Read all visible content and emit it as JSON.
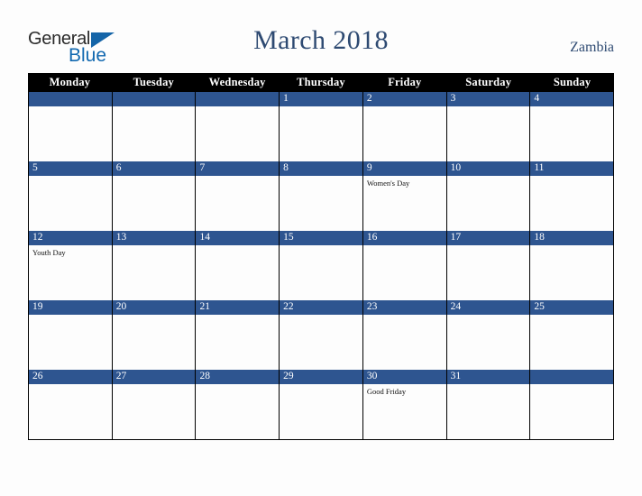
{
  "brand": {
    "name_part1": "General",
    "name_part2": "Blue",
    "triangle_icon": "blue-triangle-icon",
    "colors": {
      "general_text": "#2b2b2b",
      "blue_text": "#1269b0",
      "triangle": "#1565a8"
    }
  },
  "header": {
    "title": "March 2018",
    "country": "Zambia",
    "title_color": "#2e4a72"
  },
  "calendar": {
    "month": "March",
    "year": "2018",
    "weekday_headers": [
      "Monday",
      "Tuesday",
      "Wednesday",
      "Thursday",
      "Friday",
      "Saturday",
      "Sunday"
    ],
    "header_bg": "#000000",
    "header_text_color": "#ffffff",
    "date_bar_color": "#2e5590",
    "date_text_color": "#ffffff",
    "cell_bg": "#fdfdfd",
    "grid_line_color": "#000000",
    "weeks": [
      [
        {
          "num": "",
          "events": []
        },
        {
          "num": "",
          "events": []
        },
        {
          "num": "",
          "events": []
        },
        {
          "num": "1",
          "events": []
        },
        {
          "num": "2",
          "events": []
        },
        {
          "num": "3",
          "events": []
        },
        {
          "num": "4",
          "events": []
        }
      ],
      [
        {
          "num": "5",
          "events": []
        },
        {
          "num": "6",
          "events": []
        },
        {
          "num": "7",
          "events": []
        },
        {
          "num": "8",
          "events": []
        },
        {
          "num": "9",
          "events": [
            "Women's Day"
          ]
        },
        {
          "num": "10",
          "events": []
        },
        {
          "num": "11",
          "events": []
        }
      ],
      [
        {
          "num": "12",
          "events": [
            "Youth Day"
          ]
        },
        {
          "num": "13",
          "events": []
        },
        {
          "num": "14",
          "events": []
        },
        {
          "num": "15",
          "events": []
        },
        {
          "num": "16",
          "events": []
        },
        {
          "num": "17",
          "events": []
        },
        {
          "num": "18",
          "events": []
        }
      ],
      [
        {
          "num": "19",
          "events": []
        },
        {
          "num": "20",
          "events": []
        },
        {
          "num": "21",
          "events": []
        },
        {
          "num": "22",
          "events": []
        },
        {
          "num": "23",
          "events": []
        },
        {
          "num": "24",
          "events": []
        },
        {
          "num": "25",
          "events": []
        }
      ],
      [
        {
          "num": "26",
          "events": []
        },
        {
          "num": "27",
          "events": []
        },
        {
          "num": "28",
          "events": []
        },
        {
          "num": "29",
          "events": []
        },
        {
          "num": "30",
          "events": [
            "Good Friday"
          ]
        },
        {
          "num": "31",
          "events": []
        },
        {
          "num": "",
          "events": []
        }
      ]
    ]
  }
}
